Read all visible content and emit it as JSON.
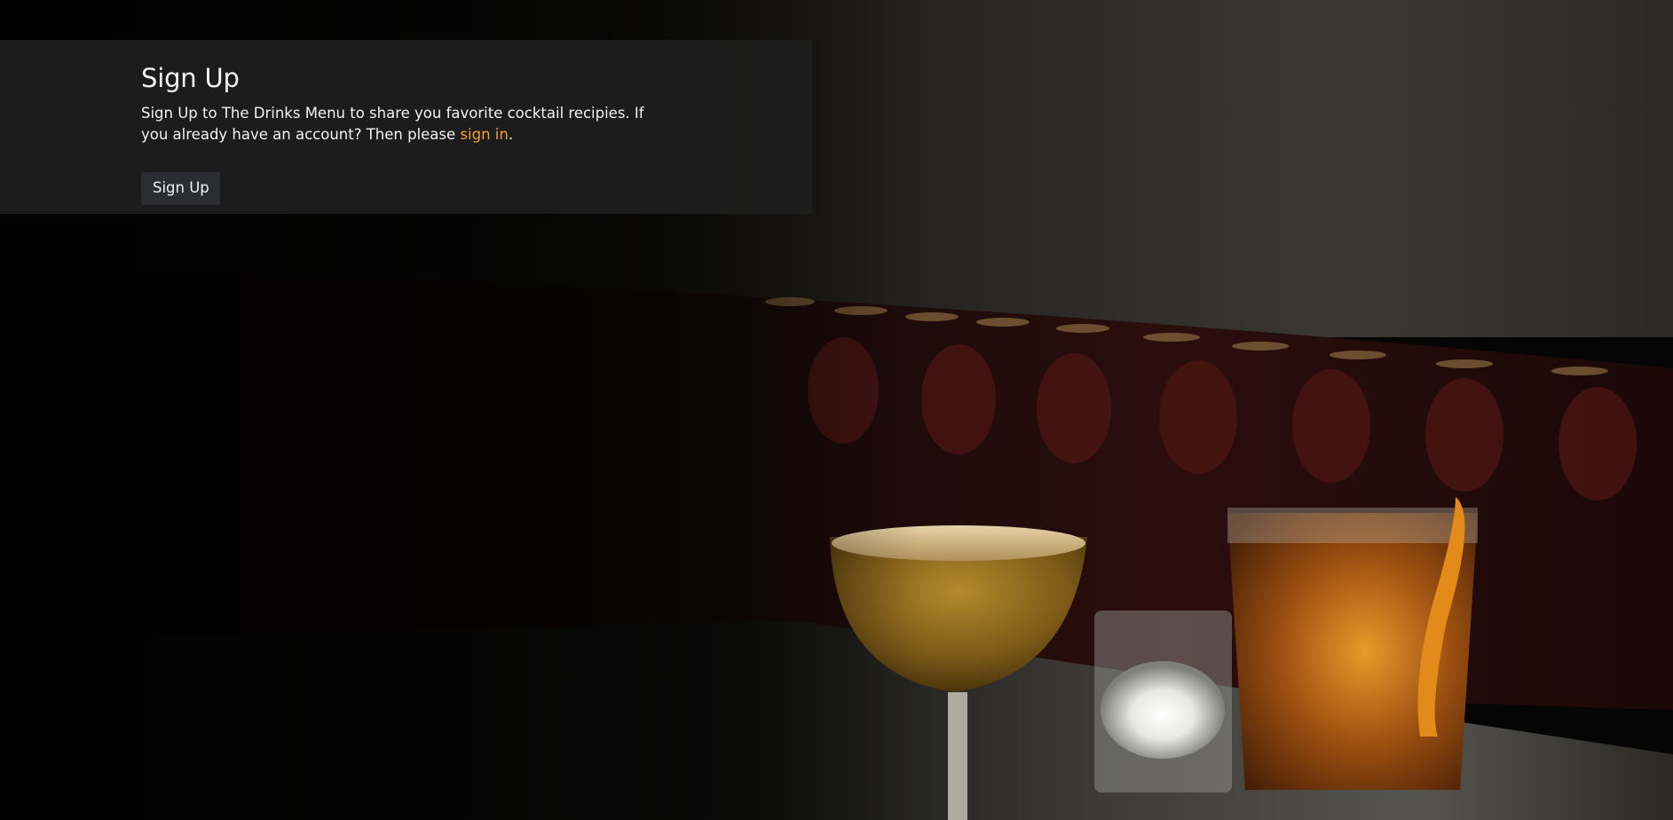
{
  "signup": {
    "title": "Sign Up",
    "description_before": "Sign Up to The Drinks Menu to share you favorite cocktail recipies. If you already have an account? Then please ",
    "signin_link": "sign in",
    "description_after": ".",
    "button_label": "Sign Up"
  },
  "background": {
    "subject": "bar-scene-cocktails-photo"
  },
  "colors": {
    "link": "#f0a030",
    "panel": "#1e1e1e",
    "button": "#2b2d30",
    "text": "#f2f2f2"
  }
}
